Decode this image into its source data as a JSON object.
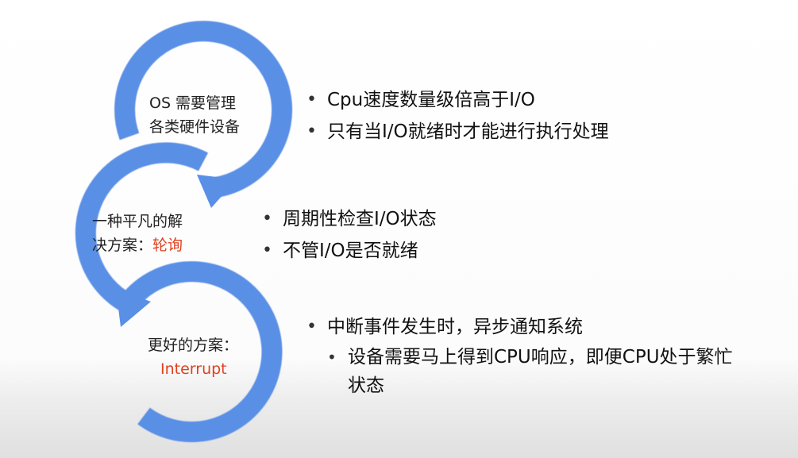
{
  "stages": [
    {
      "lines": [
        "OS 需要管理",
        "各类硬件设备"
      ]
    },
    {
      "lines": [
        "一种平凡的解",
        "决方案："
      ],
      "accent": "轮询"
    },
    {
      "lines": [
        "更好的方案："
      ],
      "accent": "Interrupt"
    }
  ],
  "bullets": {
    "stage1": [
      "Cpu速度数量级倍高于I/O",
      "只有当I/O就绪时才能进行执行处理"
    ],
    "stage2": [
      "周期性检查I/O状态",
      "不管I/O是否就绪"
    ],
    "stage3": {
      "main": "中断事件发生时，异步通知系统",
      "sub": "设备需要马上得到CPU响应，即便CPU处于繁忙状态"
    }
  },
  "bullet_symbol": "•",
  "colors": {
    "arc_blue": "#5a8fe6",
    "accent_red": "#e0401e"
  }
}
